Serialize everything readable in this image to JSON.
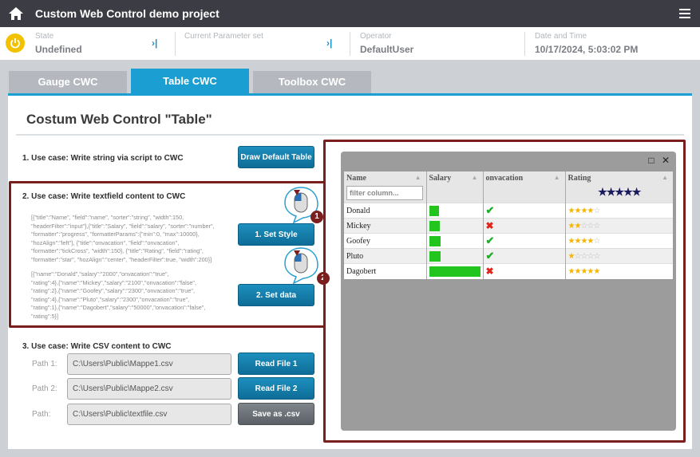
{
  "app": {
    "title": "Custom Web Control demo project"
  },
  "status": {
    "state_label": "State",
    "state_value": "Undefined",
    "param_label": "Current Parameter set",
    "param_value": "",
    "operator_label": "Operator",
    "operator_value": "DefaultUser",
    "datetime_label": "Date and Time",
    "datetime_value": "10/17/2024, 5:03:02 PM"
  },
  "tabs": [
    {
      "label": "Gauge CWC",
      "active": false
    },
    {
      "label": "Table CWC",
      "active": true
    },
    {
      "label": "Toolbox CWC",
      "active": false
    }
  ],
  "page": {
    "heading": "Costum Web Control \"Table\""
  },
  "usecase1": {
    "title": "1. Use case: Write string via script to CWC",
    "button": "Draw Default Table"
  },
  "usecase2": {
    "title": "2. Use case: Write textfield content to CWC",
    "style_lines": [
      "[{\"title\":\"Name\", \"field\":\"name\", \"sorter\":\"string\", \"width\":150,",
      "\"headerFilter\":\"input\"},{\"title\":\"Salary\", \"field\":\"salary\", \"sorter\":\"number\",",
      "\"formatter\":\"progress\", \"formatterParams\":{\"min\":0, \"max\":10000},",
      "\"hozAlign\":\"left\"}, {\"title\":\"onvacation\", \"field\":\"onvacation\",",
      "\"formatter\":\"tickCross\", \"width\":150}, {\"title\":\"Rating\", \"field\":\"rating\",",
      "\"formatter\":\"star\", \"hozAlign\":\"center\", \"headerFilter\":true, \"width\":200}]"
    ],
    "data_lines": [
      "[{\"name\":\"Donald\",\"salary\":\"2000\",\"onvacation\":\"true\",",
      "\"rating\":4},{\"name\":\"Mickey\",\"salary\":\"2100\",\"onvacation\":\"false\",",
      "\"rating\":2},{\"name\":\"Goofey\",\"salary\":\"2300\",\"onvacation\":\"true\",",
      "\"rating\":4},{\"name\":\"Pluto\",\"salary\":\"2300\",\"onvacation\":\"true\",",
      "\"rating\":1},{\"name\":\"Dagobert\",\"salary\":\"50000\",\"onvacation\":\"false\",",
      "\"rating\":5}]"
    ],
    "style_button": "1. Set Style",
    "data_button": "2. Set data",
    "marker1": "1",
    "marker2": "2"
  },
  "usecase3": {
    "title": "3. Use case: Write CSV content to CWC",
    "rows": [
      {
        "label": "Path 1:",
        "value": "C:\\Users\\Public\\Mappe1.csv",
        "button": "Read File 1",
        "variant": "blue"
      },
      {
        "label": "Path 2:",
        "value": "C:\\Users\\Public\\Mappe2.csv",
        "button": "Read File 2",
        "variant": "blue"
      },
      {
        "label": "Path:",
        "value": "C:\\Users\\Public\\textfile.csv",
        "button": "Save as .csv",
        "variant": "grey"
      }
    ]
  },
  "table": {
    "columns": [
      "Name",
      "Salary",
      "onvacation",
      "Rating"
    ],
    "filter_placeholder": "filter column...",
    "header_rating_stars": 5,
    "rows": [
      {
        "name": "Donald",
        "salary": 2000,
        "onvacation": true,
        "rating": 4
      },
      {
        "name": "Mickey",
        "salary": 2100,
        "onvacation": false,
        "rating": 2
      },
      {
        "name": "Goofey",
        "salary": 2300,
        "onvacation": true,
        "rating": 4
      },
      {
        "name": "Pluto",
        "salary": 2300,
        "onvacation": true,
        "rating": 1
      },
      {
        "name": "Dagobert",
        "salary": 50000,
        "onvacation": false,
        "rating": 5
      }
    ],
    "salary_max": 10000
  },
  "colors": {
    "accent": "#1b9fd3",
    "highlight": "#7a1e1e",
    "progress": "#22c51d"
  }
}
